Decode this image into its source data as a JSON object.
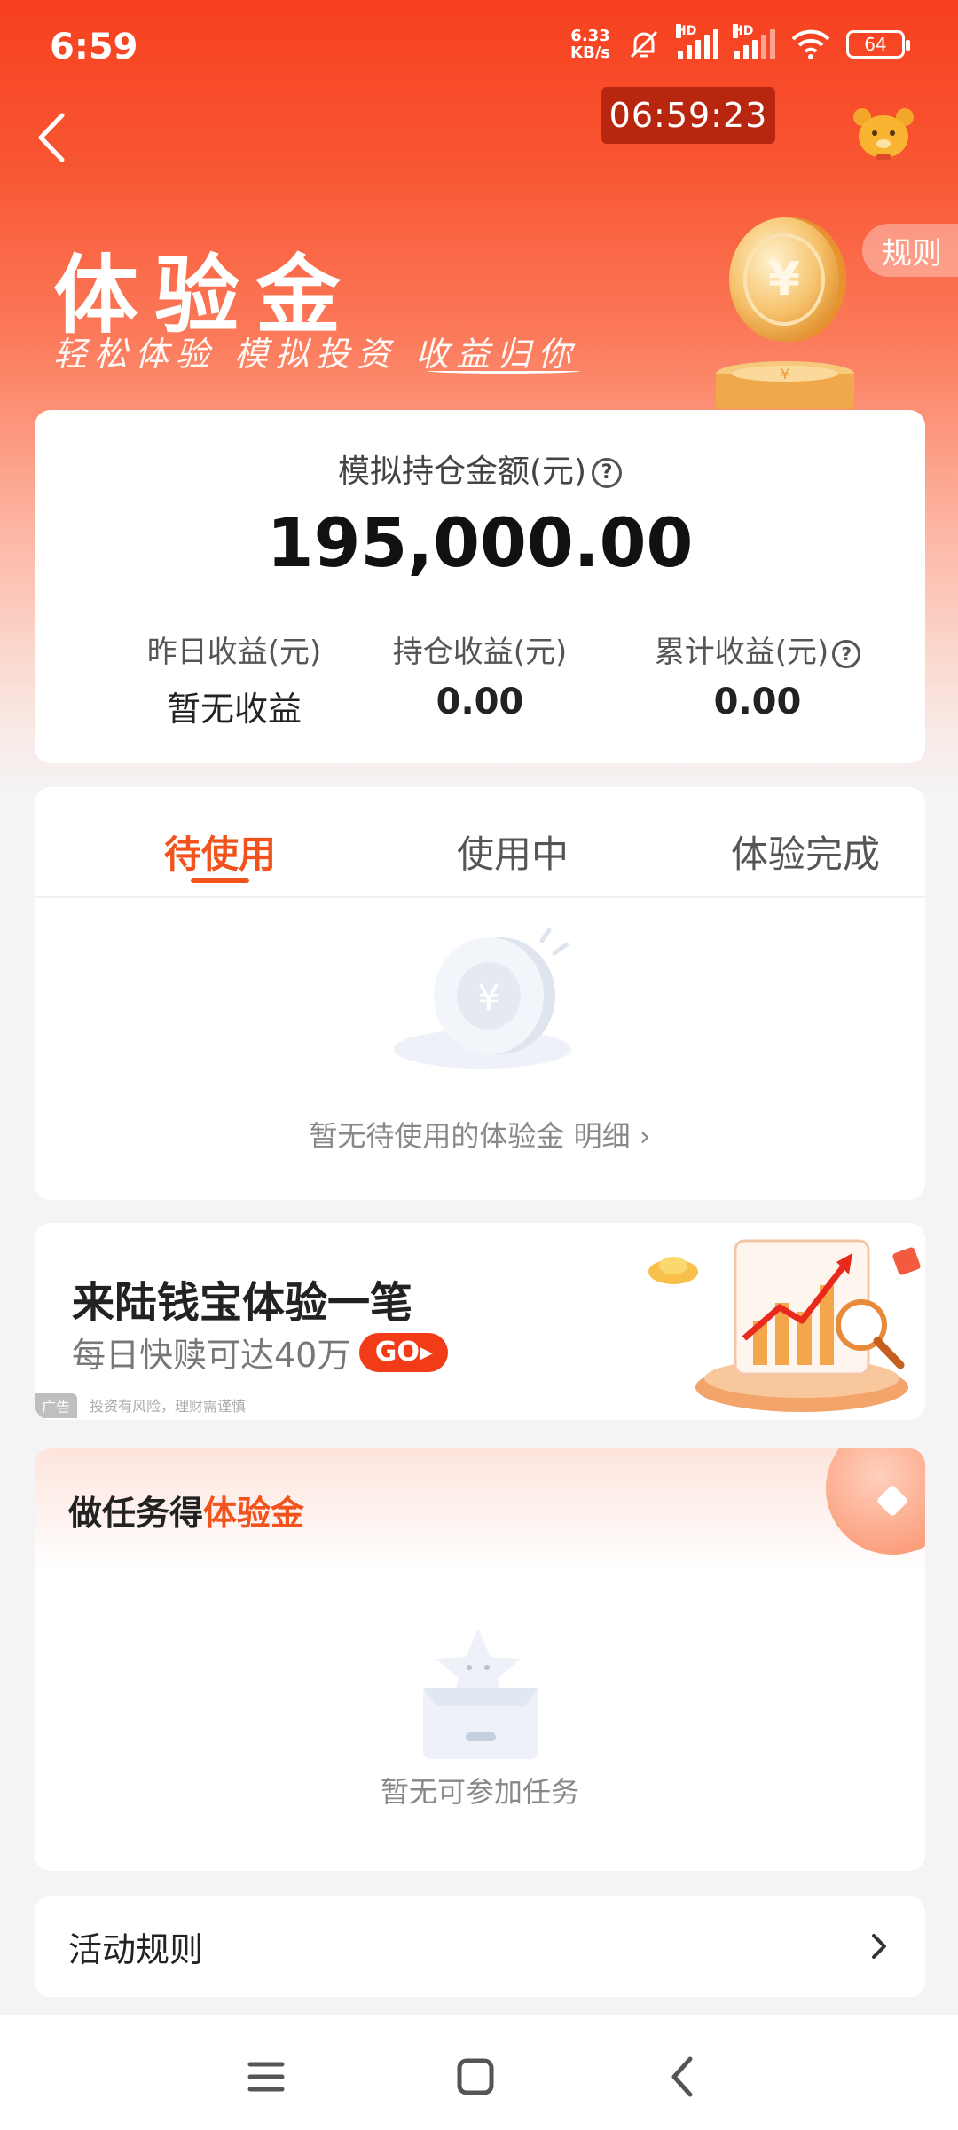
{
  "status_bar": {
    "time": "6:59",
    "net_speed_value": "6.33",
    "net_speed_unit": "KB/s",
    "sim1_label": "HD",
    "sim2_label": "HD",
    "battery": "64"
  },
  "header": {
    "timer": "06:59:23",
    "rules_label": "规则"
  },
  "hero": {
    "title": "体验金",
    "subtitle": "轻松体验 模拟投资 收益归你"
  },
  "holding": {
    "label": "模拟持仓金额(元)",
    "amount": "195,000.00",
    "stats": [
      {
        "label": "昨日收益(元)",
        "value": "暂无收益"
      },
      {
        "label": "持仓收益(元)",
        "value": "0.00"
      },
      {
        "label": "累计收益(元)",
        "value": "0.00"
      }
    ]
  },
  "tabs": {
    "items": [
      {
        "label": "待使用",
        "active": true
      },
      {
        "label": "使用中",
        "active": false
      },
      {
        "label": "体验完成",
        "active": false
      }
    ],
    "empty_text": "暂无待使用的体验金 明细 ›"
  },
  "ad": {
    "title": "来陆钱宝体验一笔",
    "subtitle": "每日快赎可达40万",
    "go_label": "GO▸",
    "badge": "广告",
    "disclaimer": "投资有风险，理财需谨慎"
  },
  "tasks": {
    "title_prefix": "做任务得",
    "title_highlight": "体验金",
    "empty_text": "暂无可参加任务"
  },
  "activity_rules": {
    "label": "活动规则"
  },
  "colors": {
    "brand": "#f2531c",
    "hero_red": "#f7401f",
    "go_red": "#f23b17"
  }
}
